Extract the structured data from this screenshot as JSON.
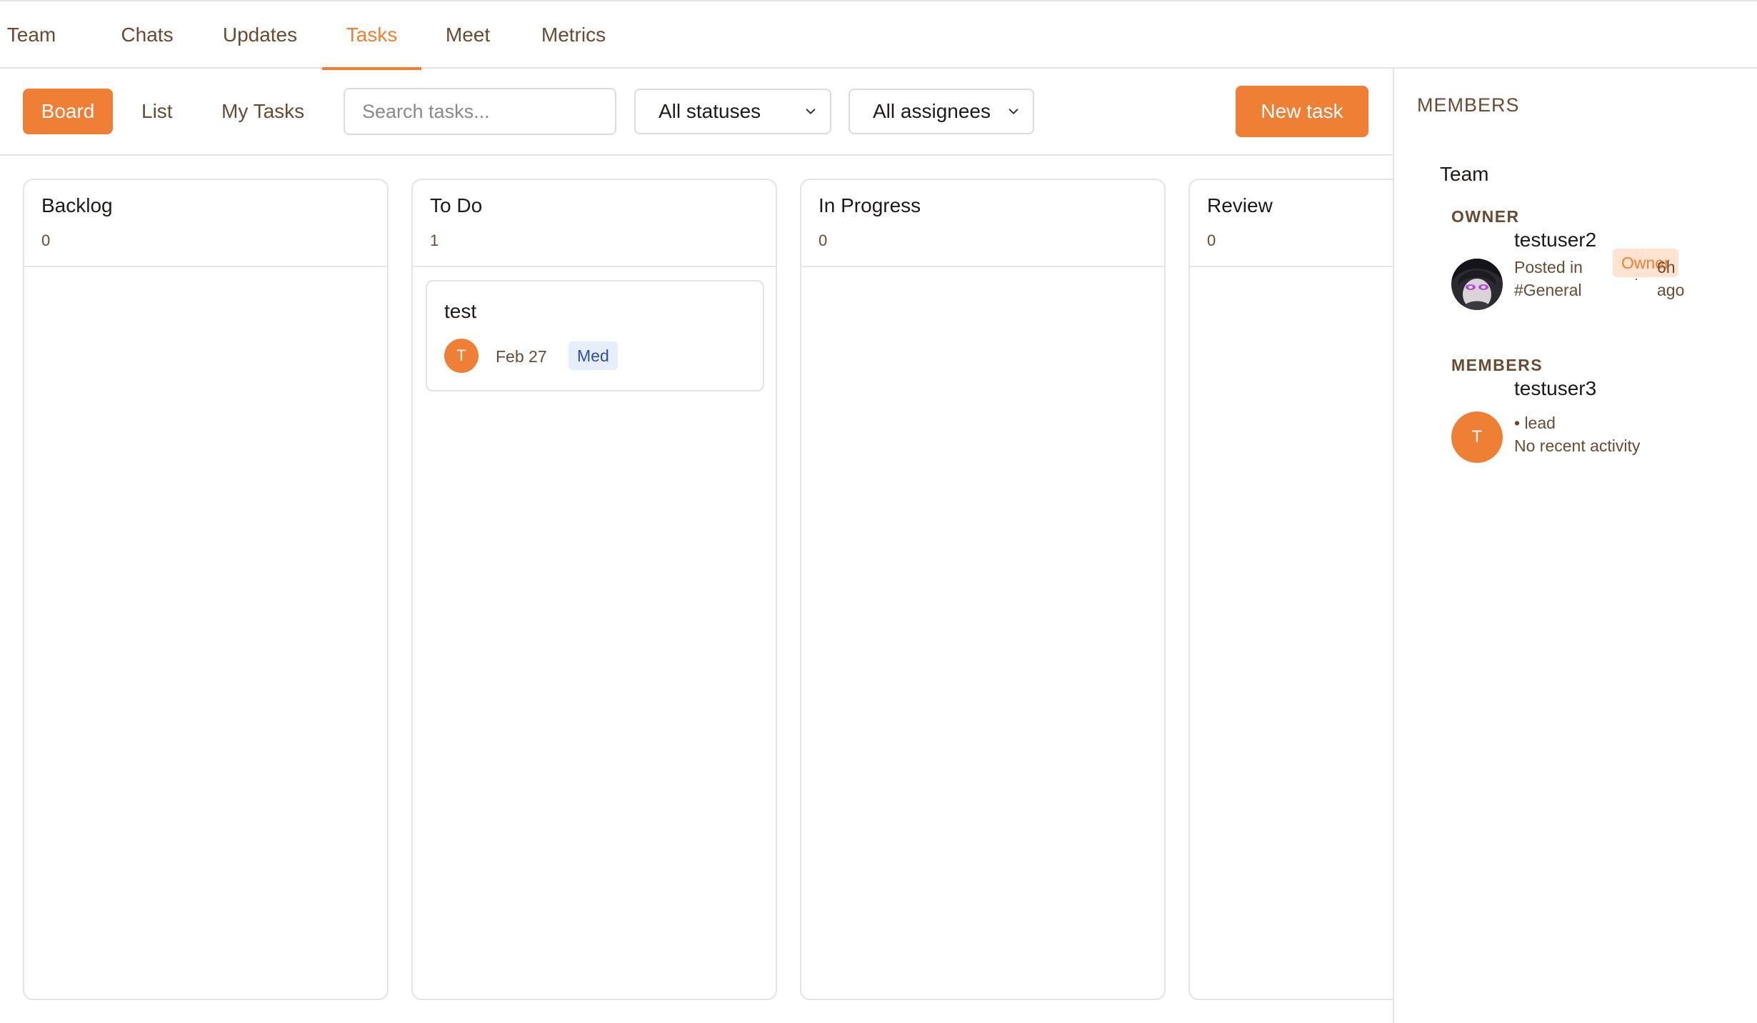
{
  "tabs": [
    {
      "label": "Team",
      "active": false
    },
    {
      "label": "Chats",
      "active": false
    },
    {
      "label": "Updates",
      "active": false
    },
    {
      "label": "Tasks",
      "active": true
    },
    {
      "label": "Meet",
      "active": false
    },
    {
      "label": "Metrics",
      "active": false
    }
  ],
  "toolbar": {
    "views": [
      "Board",
      "List",
      "My Tasks"
    ],
    "active_view": "Board",
    "search_placeholder": "Search tasks...",
    "status_filter": "All statuses",
    "assignee_filter": "All assignees",
    "new_task_label": "New task"
  },
  "columns": [
    {
      "title": "Backlog",
      "count": "0",
      "cards": []
    },
    {
      "title": "To Do",
      "count": "1",
      "cards": [
        {
          "title": "test",
          "avatar": "T",
          "date": "Feb 27",
          "priority": "Med"
        }
      ]
    },
    {
      "title": "In Progress",
      "count": "0",
      "cards": []
    },
    {
      "title": "Review",
      "count": "0",
      "cards": []
    }
  ],
  "members_panel": {
    "title": "MEMBERS",
    "team_name": "Team",
    "owner_section": "OWNER",
    "owner": {
      "name": "testuser2",
      "badge": "Owner",
      "activity_line1": "Posted in",
      "activity_line2": "#General",
      "dot": "·",
      "time_line1": "6h",
      "time_line2": "ago"
    },
    "members_section": "MEMBERS",
    "members": [
      {
        "name": "testuser3",
        "avatar": "T",
        "role": "• lead",
        "activity": "No recent activity"
      }
    ]
  },
  "colors": {
    "accent": "#ef7f35",
    "text_brown": "#6a4a33",
    "badge_blue_bg": "#e6edfb",
    "badge_blue_text": "#2f4fa3",
    "owner_badge_bg": "#fde3d0"
  }
}
